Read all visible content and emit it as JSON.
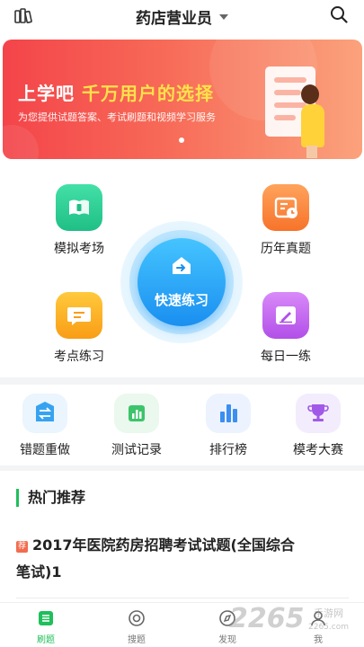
{
  "header": {
    "title": "药店营业员",
    "left_icon": "books-icon",
    "search_icon": "search-icon"
  },
  "banner": {
    "title_part1": "上学吧",
    "title_part2": "千万用户的选择",
    "subtitle": "为您提供试题答案、考试刷题和视频学习服务",
    "colors": {
      "start": "#f4444a",
      "end": "#fba27c",
      "highlight": "#ffe24a"
    }
  },
  "features": {
    "mock_exam": {
      "label": "模拟考场",
      "icon": "book-icon",
      "color": "#2fcf95"
    },
    "past_papers": {
      "label": "历年真题",
      "icon": "calendar-clock-icon",
      "color": "#f9823c"
    },
    "quick_practice": {
      "label": "快速练习",
      "icon": "arrow-right-icon",
      "color": "#1a8ff0"
    },
    "point_practice": {
      "label": "考点练习",
      "icon": "chat-icon",
      "color": "#fbaa1d"
    },
    "daily_practice": {
      "label": "每日一练",
      "icon": "edit-icon",
      "color": "#c163f0"
    }
  },
  "secondary": [
    {
      "label": "错题重做",
      "icon": "swap-icon",
      "color": "#37a3f0"
    },
    {
      "label": "测试记录",
      "icon": "bar-chart-icon",
      "color": "#3cc46a"
    },
    {
      "label": "排行榜",
      "icon": "ranking-icon",
      "color": "#3b8ff0"
    },
    {
      "label": "模考大赛",
      "icon": "trophy-icon",
      "color": "#a15ae8"
    }
  ],
  "hot": {
    "title": "热门推荐",
    "tag": "荐",
    "article_line1": "2017年医院药房招聘考试试题(全国综合",
    "article_line2": "笔试)1"
  },
  "tabbar": [
    {
      "label": "刷题",
      "icon": "list-icon",
      "active": true
    },
    {
      "label": "搜题",
      "icon": "search-circle-icon",
      "active": false
    },
    {
      "label": "发现",
      "icon": "compass-icon",
      "active": false
    },
    {
      "label": "我",
      "icon": "user-icon",
      "active": false
    }
  ],
  "watermark": {
    "text": "2265",
    "suffix": "手游网",
    "url": "2265.com"
  },
  "accent_color": "#1fbf5a"
}
